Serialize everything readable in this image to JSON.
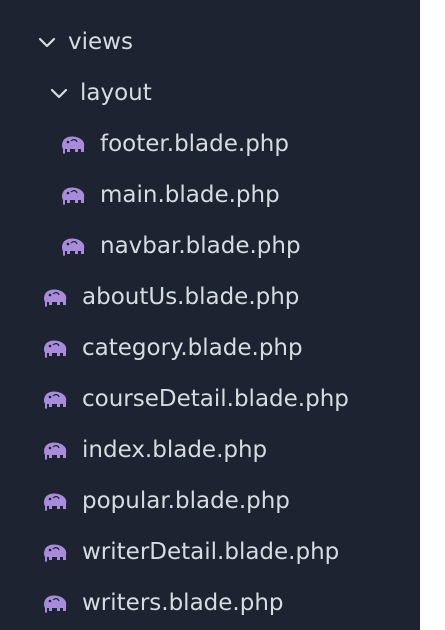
{
  "explorer": {
    "folders": [
      {
        "label": "views",
        "expanded": true
      },
      {
        "label": "layout",
        "expanded": true
      }
    ],
    "layout_files": [
      {
        "label": "footer.blade.php"
      },
      {
        "label": "main.blade.php"
      },
      {
        "label": "navbar.blade.php"
      }
    ],
    "view_files": [
      {
        "label": "aboutUs.blade.php"
      },
      {
        "label": "category.blade.php"
      },
      {
        "label": "courseDetail.blade.php"
      },
      {
        "label": "index.blade.php"
      },
      {
        "label": "popular.blade.php"
      },
      {
        "label": "writerDetail.blade.php"
      },
      {
        "label": "writers.blade.php"
      }
    ],
    "icons": {
      "folder_toggle": "chevron-down-icon",
      "file": "php-elephant-icon"
    },
    "colors": {
      "background": "#1d2331",
      "text": "#d7dbe2",
      "php_icon": "#a98bdc"
    }
  }
}
